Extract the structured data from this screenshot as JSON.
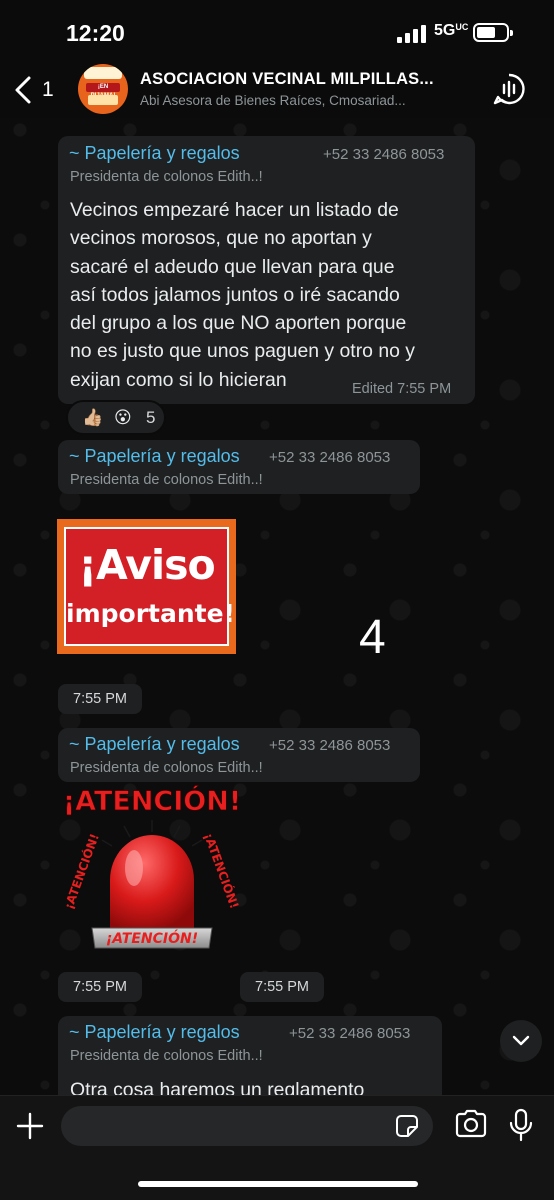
{
  "status_bar": {
    "time": "12:20",
    "network": "5G",
    "network_sup": "UC"
  },
  "header": {
    "back_count": "1",
    "group_name": "ASOCIACION VECINAL MILPILLAS...",
    "group_members": "Abi Asesora de Bienes Raíces, Cmosariad...",
    "avatar_text": "¡EN PIJAMA!"
  },
  "messages": [
    {
      "sender": "~ Papelería y regalos",
      "phone": "+52 33 2486 8053",
      "role": "Presidenta de colonos Edith..!",
      "lines": [
        "Vecinos empezaré hacer  un listado de",
        "vecinos morosos, que no aportan y",
        "sacaré el adeudo que llevan para que",
        "así todos jalamos juntos o iré sacando",
        "del grupo a los que NO aporten porque",
        "no es justo que unos paguen y otro no y",
        "exijan como si lo hicieran"
      ],
      "meta": "Edited 7:55 PM",
      "reactions": {
        "emoji_1": "👍🏼",
        "emoji_2": "😮",
        "count": "5"
      }
    },
    {
      "sender": "~ Papelería y regalos",
      "phone": "+52 33 2486 8053",
      "role": "Presidenta de colonos Edith..!",
      "sticker_line_1": "¡Aviso",
      "sticker_line_2": "importante!",
      "sticker_count": "4",
      "time": "7:55 PM"
    },
    {
      "sender": "~ Papelería y regalos",
      "phone": "+52 33 2486 8053",
      "role": "Presidenta de colonos Edith..!",
      "sticker_title": "¡ATENCIÓN!",
      "sticker_side_left": "¡ATENCIÓN!",
      "sticker_side_right": "¡ATENCIÓN!",
      "sticker_base": "¡ATENCIÓN!",
      "time_1": "7:55 PM",
      "time_2": "7:55 PM"
    },
    {
      "sender": "~ Papelería y regalos",
      "phone": "+52 33 2486 8053",
      "role": "Presidenta de colonos Edith..!",
      "text_partial": "Otra cosa haremos un reglamento"
    }
  ],
  "icons": {
    "back": "chevron-left-icon",
    "audio_call": "voice-chat-icon",
    "scroll_down": "chevron-down-icon",
    "attach": "plus-icon",
    "sticker": "sticker-icon",
    "camera": "camera-icon",
    "mic": "microphone-icon"
  },
  "colors": {
    "sender": "#53bdeb",
    "bubble": "#1f2021",
    "sticker_red": "#d32027",
    "sticker_orange": "#e96a1c"
  }
}
